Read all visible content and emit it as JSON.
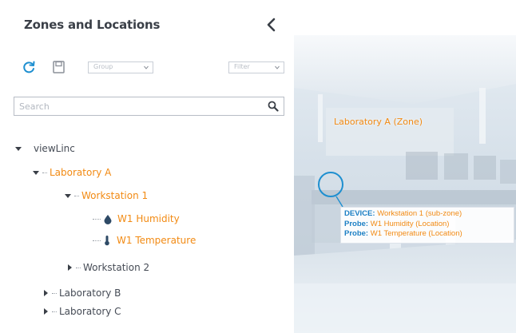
{
  "panel": {
    "title": "Zones and Locations",
    "toolbar": {
      "group_dropdown": "Group",
      "view_dropdown": "Filter"
    },
    "search": {
      "placeholder": "Search"
    }
  },
  "tree": {
    "root": "viewLinc",
    "laboratory_a": "Laboratory A",
    "workstation_1": "Workstation 1",
    "w1_humidity": "W1 Humidity",
    "w1_temperature": "W1 Temperature",
    "workstation_2": "Workstation 2",
    "laboratory_b": "Laboratory B",
    "laboratory_c": "Laboratory C"
  },
  "image": {
    "zone_label": "Laboratory A (Zone)",
    "tooltip": {
      "device_key": "DEVICE:",
      "device_value": "Workstation 1 (sub-zone)",
      "probe1_key": "Probe:",
      "probe1_value": "W1 Humidity (Location)",
      "probe2_key": "Probe:",
      "probe2_value": "W1 Temperature (Location)"
    }
  },
  "colors": {
    "accent_orange": "#f28a13",
    "accent_blue": "#1e8fd0",
    "text_dark": "#3a3f47"
  },
  "icons": [
    "chevron-left-icon",
    "refresh-icon",
    "save-icon",
    "search-icon",
    "expand-icon",
    "collapse-icon",
    "droplet-icon",
    "thermometer-icon"
  ]
}
